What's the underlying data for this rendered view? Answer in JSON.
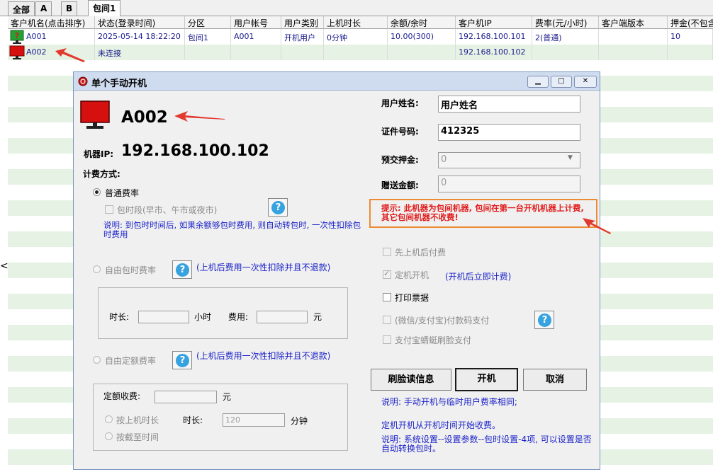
{
  "tabs": [
    "全部",
    "A",
    "B",
    "包间1"
  ],
  "grid": {
    "headers": [
      "客户机名(点击排序)",
      "状态(登录时间)",
      "分区",
      "用户帐号",
      "用户类别",
      "上机时长",
      "余额/余时",
      "客户机IP",
      "费率(元/小时)",
      "客户端版本",
      "押金(不包含"
    ],
    "rows": [
      {
        "name": "A001",
        "status": "2025-05-14 18:22:20",
        "zone": "包间1",
        "account": "A001",
        "type": "开机用户",
        "duration": "0分钟",
        "balance": "10.00(300)",
        "ip": "192.168.100.101",
        "rate": "2(普通)",
        "version": "",
        "deposit": "10"
      },
      {
        "name": "A002",
        "status": "未连接",
        "zone": "",
        "account": "",
        "type": "",
        "duration": "",
        "balance": "",
        "ip": "192.168.100.102",
        "rate": "",
        "version": "",
        "deposit": ""
      }
    ]
  },
  "collapse_arrow": "<",
  "dialog": {
    "title": "单个手动开机",
    "machine_name": "A002",
    "ip_label": "机器IP:",
    "ip_value": "192.168.100.102",
    "billing_label": "计费方式:",
    "normal_rate": "普通费率",
    "package_period": "包时段(早市、午市或夜市)",
    "package_note": "说明: 到包时时间后, 如果余额够包时费用, 则自动转包时, 一次性扣除包时费用",
    "free_package": "自由包时费率",
    "free_package_note": "(上机后费用一次性扣除并且不退款)",
    "duration_label": "时长:",
    "hours_unit": "小时",
    "fee_label": "费用:",
    "yuan": "元",
    "fixed_rate": "自由定额费率",
    "fixed_rate_note": "(上机后费用一次性扣除并且不退款)",
    "fixed_fee_label": "定额收费:",
    "by_duration": "按上机时长",
    "duration2_label": "时长:",
    "duration2_value": "120",
    "minutes_unit": "分钟",
    "by_deadline": "按截至时间",
    "user_name_label": "用户姓名:",
    "user_name_value": "用户姓名",
    "id_label": "证件号码:",
    "id_value": "412325",
    "deposit_label": "预交押金:",
    "deposit_value": "0",
    "gift_label": "赠送金额:",
    "gift_value": "0",
    "hint": "提示: 此机器为包间机器, 包间在第一台开机机器上计费, 其它包间机器不收费!",
    "pay_after": "先上机后付费",
    "timed_boot": "定机开机",
    "timed_boot_note": "(开机后立即计费)",
    "print_ticket": "打印票据",
    "qr_pay": "(微信/支付宝)付款码支付",
    "face_pay": "支付宝蜻蜓刷脸支付",
    "btn_face": "刷脸读信息",
    "btn_boot": "开机",
    "btn_cancel": "取消",
    "note1": "说明: 手动开机与临时用户费率相同;",
    "note2": "定机开机从开机时间开始收费。",
    "note3": "说明: 系统设置--设置参数--包时设置-4项, 可以设置是否自动转换包时。"
  },
  "colors": {
    "hint_red": "#e21b1b",
    "hint_border": "#ec8a36",
    "arrow_red": "#e2392f",
    "monitor_red": "#d60f0f",
    "row_green": "#e6f2e4",
    "link_blue": "#1b22c8"
  }
}
